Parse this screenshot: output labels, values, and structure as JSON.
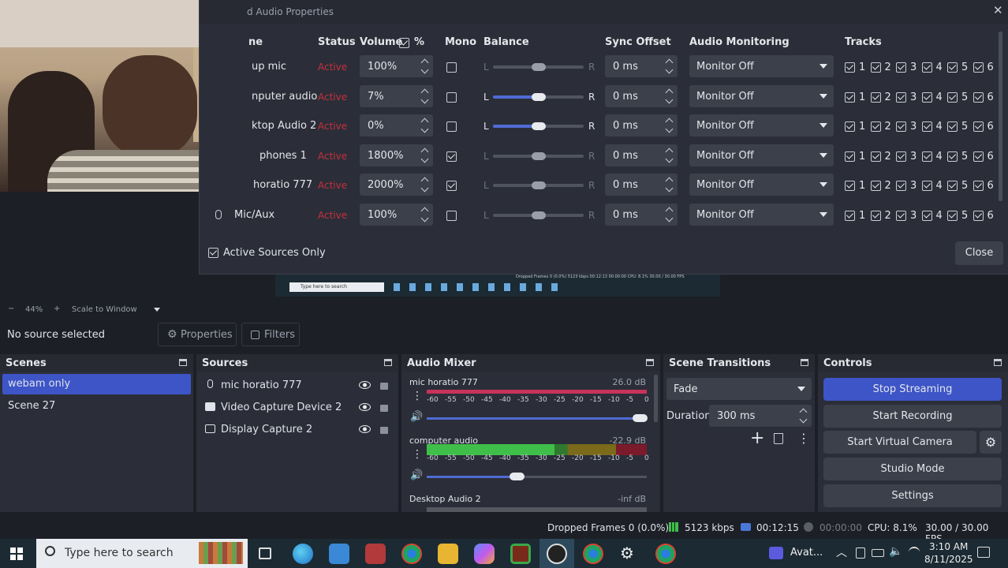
{
  "advanced_audio": {
    "title": "d Audio Properties",
    "close_x": "✕",
    "headers": {
      "name": "ne",
      "status": "Status",
      "volume": "Volume",
      "percent": "%",
      "mono": "Mono",
      "balance": "Balance",
      "sync": "Sync Offset",
      "monitoring": "Audio Monitoring",
      "tracks": "Tracks"
    },
    "rows": [
      {
        "name": "up mic",
        "status": "Active",
        "volume": "100%",
        "mono": false,
        "balance_pos": 0.5,
        "balance_active": false,
        "sync": "0 ms",
        "monitor": "Monitor Off"
      },
      {
        "name": "nputer audio",
        "status": "Active",
        "volume": "7%",
        "mono": false,
        "balance_pos": 0.5,
        "balance_active": true,
        "sync": "0 ms",
        "monitor": "Monitor Off"
      },
      {
        "name": "ktop Audio 2",
        "status": "Active",
        "volume": "0%",
        "mono": false,
        "balance_pos": 0.5,
        "balance_active": true,
        "sync": "0 ms",
        "monitor": "Monitor Off"
      },
      {
        "name": "phones 1",
        "status": "Active",
        "volume": "1800%",
        "mono": true,
        "balance_pos": 0.5,
        "balance_active": false,
        "sync": "0 ms",
        "monitor": "Monitor Off"
      },
      {
        "name": "horatio 777",
        "status": "Active",
        "volume": "2000%",
        "mono": true,
        "balance_pos": 0.5,
        "balance_active": false,
        "sync": "0 ms",
        "monitor": "Monitor Off"
      },
      {
        "name": "Mic/Aux",
        "status": "Active",
        "volume": "100%",
        "mono": false,
        "balance_pos": 0.5,
        "balance_active": false,
        "sync": "0 ms",
        "monitor": "Monitor Off"
      }
    ],
    "balance_l": "L",
    "balance_r": "R",
    "track_labels": [
      "1",
      "2",
      "3",
      "4",
      "5",
      "6"
    ],
    "active_only_label": "Active Sources Only",
    "close_button": "Close"
  },
  "preview": {
    "zoom": "44%",
    "scale_mode": "Scale to Window",
    "minus": "−",
    "plus": "+",
    "mini_taskbar_search": "Type here to search",
    "mini_status": "Dropped Frames 0 (0.0%)   5123 kbps   00:12:13   00:00:00   CPU: 8.1%   30.00 / 30.00 FPS"
  },
  "source_toolbar": {
    "no_source": "No source selected",
    "properties": "Properties",
    "filters": "Filters"
  },
  "scenes": {
    "title": "Scenes",
    "items": [
      "webam only",
      "Scene 27"
    ],
    "selected": 0
  },
  "sources": {
    "title": "Sources",
    "items": [
      {
        "label": "mic horatio 777",
        "icon": "mic-icon"
      },
      {
        "label": "Video Capture Device 2",
        "icon": "camera-icon"
      },
      {
        "label": "Display Capture 2",
        "icon": "monitor-icon"
      }
    ]
  },
  "mixer": {
    "title": "Audio Mixer",
    "channels": [
      {
        "name": "mic horatio 777",
        "db": "26.0 dB",
        "level": 1.0,
        "vol": 1.0,
        "muted_color": "#c7335a"
      },
      {
        "name": "computer audio",
        "db": "-22.9 dB",
        "level": 0.58,
        "vol": 0.44,
        "muted_color": "#3fbf4a"
      },
      {
        "name": "Desktop Audio 2",
        "db": "-inf dB",
        "level": 0,
        "vol": 0,
        "muted_color": "#555"
      }
    ],
    "scale": [
      "-60",
      "-55",
      "-50",
      "-45",
      "-40",
      "-35",
      "-30",
      "-25",
      "-20",
      "-15",
      "-10",
      "-5",
      "0"
    ]
  },
  "transitions": {
    "title": "Scene Transitions",
    "selected": "Fade",
    "duration_label": "Duration",
    "duration": "300 ms",
    "add": "+",
    "more": "⋮"
  },
  "controls": {
    "title": "Controls",
    "stop_streaming": "Stop Streaming",
    "start_recording": "Start Recording",
    "start_virtual_camera": "Start Virtual Camera",
    "studio_mode": "Studio Mode",
    "settings": "Settings"
  },
  "statusbar": {
    "dropped": "Dropped Frames 0 (0.0%)",
    "kbps": "5123 kbps",
    "stream_time": "00:12:15",
    "rec_time": "00:00:00",
    "cpu": "CPU: 8.1%",
    "fps": "30.00 / 30.00 FPS"
  },
  "taskbar": {
    "search_placeholder": "Type here to search",
    "app_label": "Avat...",
    "time": "3:10 AM",
    "date": "8/11/2025"
  },
  "colors": {
    "accent": "#3d55c7",
    "status_red": "#c6303e",
    "panel": "#2b2e38",
    "bg": "#1d1f26"
  }
}
